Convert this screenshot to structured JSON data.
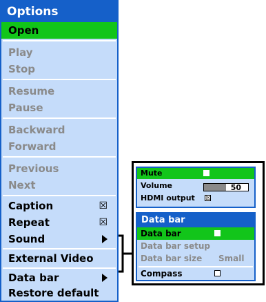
{
  "options_menu": {
    "title": "Options",
    "items": [
      {
        "label": "Open",
        "state": "highlighted"
      },
      {
        "label": "Play",
        "state": "disabled"
      },
      {
        "label": "Stop",
        "state": "disabled"
      },
      {
        "label": "Resume",
        "state": "disabled"
      },
      {
        "label": "Pause",
        "state": "disabled"
      },
      {
        "label": "Backward",
        "state": "disabled"
      },
      {
        "label": "Forward",
        "state": "disabled"
      },
      {
        "label": "Previous",
        "state": "disabled"
      },
      {
        "label": "Next",
        "state": "disabled"
      },
      {
        "label": "Caption",
        "state": "enabled",
        "checked": true
      },
      {
        "label": "Repeat",
        "state": "enabled",
        "checked": true
      },
      {
        "label": "Sound",
        "state": "enabled",
        "submenu": true
      },
      {
        "label": "External Video",
        "state": "enabled"
      },
      {
        "label": "Data bar",
        "state": "enabled",
        "submenu": true
      },
      {
        "label": "Restore default",
        "state": "enabled"
      }
    ]
  },
  "sound_panel": {
    "mute_label": "Mute",
    "mute_checked": false,
    "volume_label": "Volume",
    "volume_value": "50",
    "volume_level_fraction": 0.5,
    "hdmi_label": "HDMI output",
    "hdmi_checked": true
  },
  "data_bar_panel": {
    "title": "Data bar",
    "rows": [
      {
        "label": "Data bar",
        "state": "highlighted",
        "checkbox": true,
        "checked": false
      },
      {
        "label": "Data bar setup",
        "state": "disabled"
      },
      {
        "label": "Data bar size",
        "state": "disabled",
        "value": "Small"
      },
      {
        "label": "Compass",
        "state": "enabled",
        "checkbox": true,
        "checked": false
      }
    ]
  },
  "colors": {
    "menu_bg": "#c5dcfa",
    "title_bar": "#1560c9",
    "highlight": "#12c51a",
    "disabled_text": "#8a8a8a"
  },
  "icons": {
    "checked_mark": "☒",
    "submenu_arrow": "triangle-right-icon"
  }
}
